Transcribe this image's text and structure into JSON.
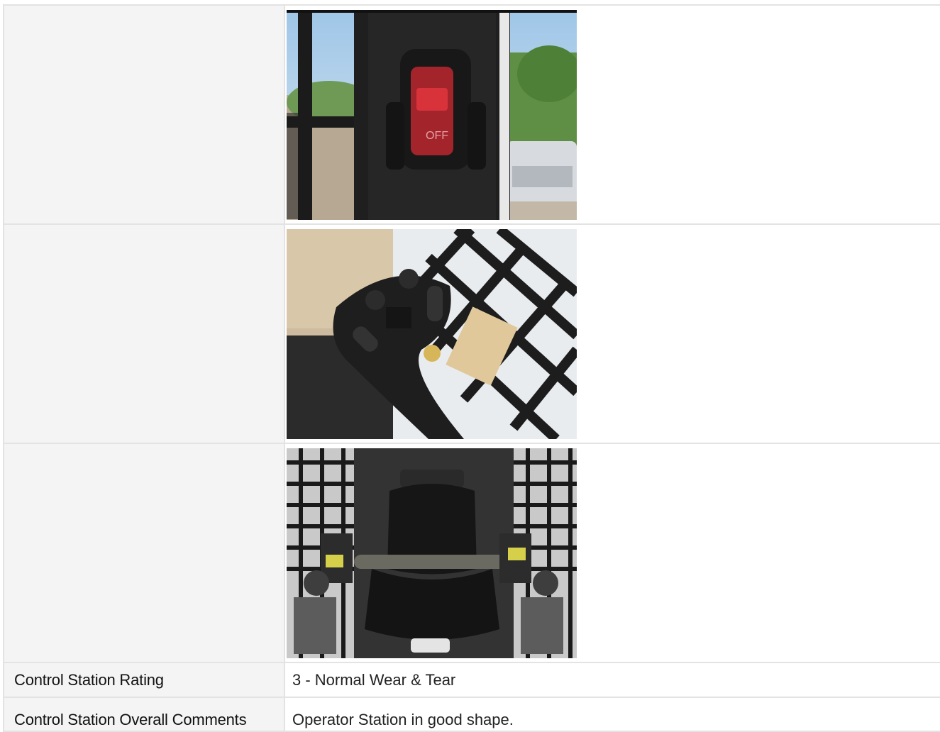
{
  "photos": [
    {
      "icon": "parking-brake-switch-photo",
      "switch_label": "OFF"
    },
    {
      "icon": "joystick-handle-photo"
    },
    {
      "icon": "operator-seat-photo"
    }
  ],
  "rows": [
    {
      "label": "Control Station Rating",
      "value": "3 - Normal Wear & Tear"
    },
    {
      "label": "Control Station Overall Comments",
      "value": "Operator Station in good shape."
    }
  ]
}
